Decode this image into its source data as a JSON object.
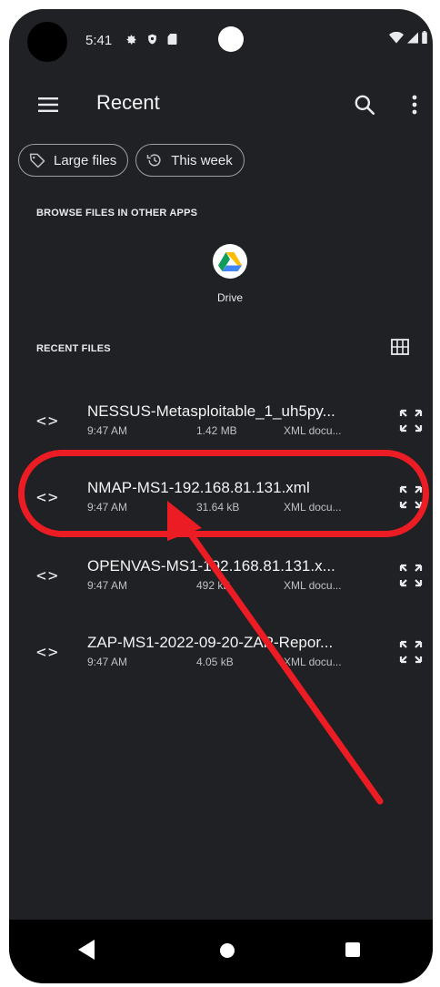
{
  "status_bar": {
    "time": "5:41"
  },
  "app_bar": {
    "title": "Recent"
  },
  "chips": [
    {
      "label": "Large files"
    },
    {
      "label": "This week"
    }
  ],
  "sections": {
    "browse_label": "BROWSE FILES IN OTHER APPS",
    "recent_label": "RECENT FILES"
  },
  "apps": [
    {
      "label": "Drive"
    }
  ],
  "files": [
    {
      "name": "NESSUS-Metasploitable_1_uh5py...",
      "time": "9:47 AM",
      "size": "1.42 MB",
      "type": "XML docu..."
    },
    {
      "name": "NMAP-MS1-192.168.81.131.xml",
      "time": "9:47 AM",
      "size": "31.64 kB",
      "type": "XML docu..."
    },
    {
      "name": "OPENVAS-MS1-192.168.81.131.x...",
      "time": "9:47 AM",
      "size": "492 kB",
      "type": "XML docu..."
    },
    {
      "name": "ZAP-MS1-2022-09-20-ZAP-Repor...",
      "time": "9:47 AM",
      "size": "4.05 kB",
      "type": "XML docu..."
    }
  ],
  "icons": {
    "file": "code-brackets-icon",
    "expand": "expand-arrows-icon"
  },
  "colors": {
    "background": "#202124",
    "annotation": "#ec1c24",
    "nav_bar": "#000000"
  }
}
